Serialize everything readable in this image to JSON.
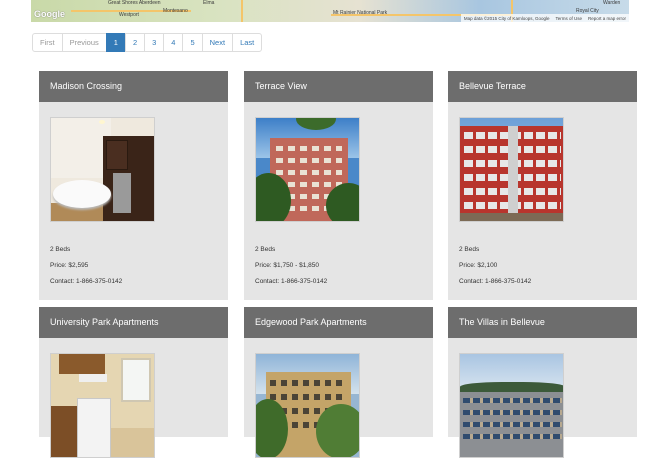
{
  "map": {
    "logo": "Google",
    "labels": [
      {
        "text": "Great Shores  Aberdeen",
        "name": "map-label-aberdeen"
      },
      {
        "text": "Montesano",
        "name": "map-label-montesano"
      },
      {
        "text": "Elma",
        "name": "map-label-elma"
      },
      {
        "text": "Westport",
        "name": "map-label-westport"
      },
      {
        "text": "Mt Rainier National Park",
        "name": "map-label-rainier"
      },
      {
        "text": "Royal City",
        "name": "map-label-royal-city"
      },
      {
        "text": "Warden",
        "name": "map-label-warden"
      }
    ],
    "attribution": {
      "data": "Map data ©2015 City of Kamloops, Google",
      "terms": "Terms of Use",
      "report": "Report a map error"
    }
  },
  "pagination": {
    "items": [
      {
        "label": "First",
        "state": "disabled"
      },
      {
        "label": "Previous",
        "state": "disabled"
      },
      {
        "label": "1",
        "state": "active"
      },
      {
        "label": "2",
        "state": "normal"
      },
      {
        "label": "3",
        "state": "normal"
      },
      {
        "label": "4",
        "state": "normal"
      },
      {
        "label": "5",
        "state": "normal"
      },
      {
        "label": "Next",
        "state": "normal"
      },
      {
        "label": "Last",
        "state": "normal"
      }
    ]
  },
  "listings": [
    {
      "title": "Madison Crossing",
      "beds": "2 Beds",
      "price": "Price: $2,595",
      "contact": "Contact: 1-866-375-0142",
      "photo": "kitchen-photo"
    },
    {
      "title": "Terrace View",
      "beds": "2 Beds",
      "price": "Price: $1,750 - $1,850",
      "contact": "Contact: 1-866-375-0142",
      "photo": "building-photo"
    },
    {
      "title": "Bellevue Terrace",
      "beds": "2 Beds",
      "price": "Price: $2,100",
      "contact": "Contact: 1-866-375-0142",
      "photo": "building-photo"
    },
    {
      "title": "University Park Apartments",
      "photo": "kitchen-photo"
    },
    {
      "title": "Edgewood Park Apartments",
      "photo": "building-photo"
    },
    {
      "title": "The Villas in Bellevue",
      "photo": "building-photo"
    }
  ],
  "colors": {
    "card_header": "#6d6d6d",
    "card_body": "#e5e5e5",
    "pager_active": "#337ab7",
    "link": "#337ab7"
  }
}
